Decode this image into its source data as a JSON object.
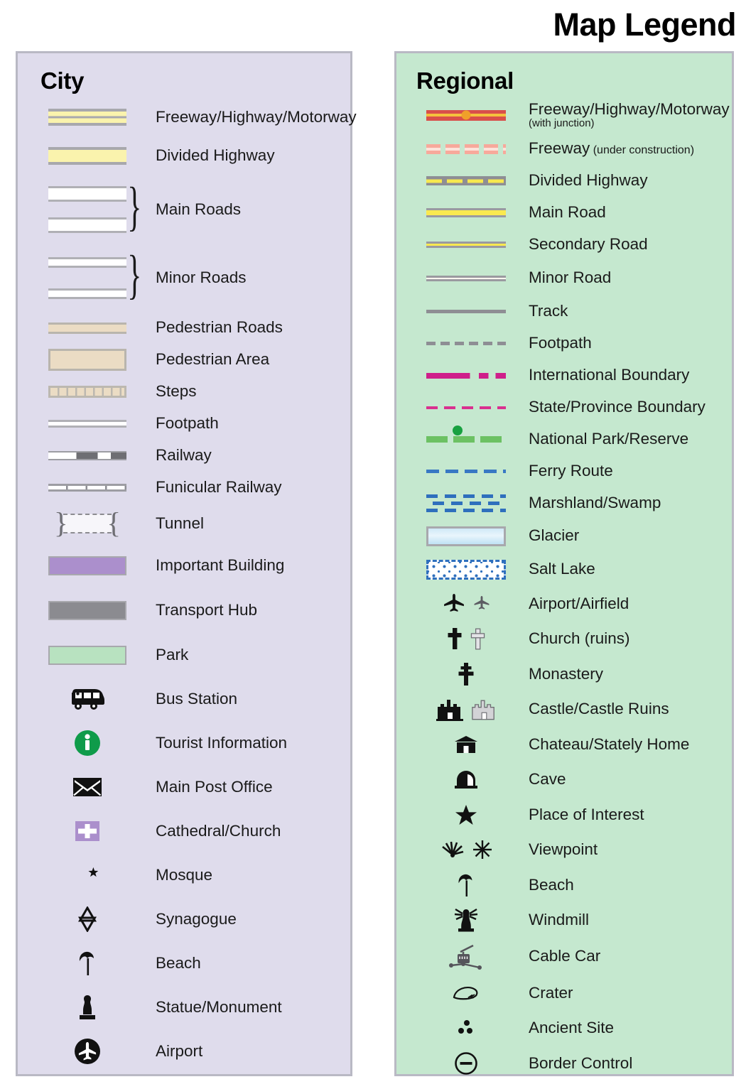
{
  "title": "Map Legend",
  "city": {
    "heading": "City",
    "road_items": [
      {
        "label": "Freeway/Highway/Motorway",
        "symbol": "freeway-bar"
      },
      {
        "label": "Divided Highway",
        "symbol": "divided-highway-bar"
      },
      {
        "label": "Main Roads",
        "symbol": "main-roads-paired-bars"
      },
      {
        "label": "Minor Roads",
        "symbol": "minor-roads-paired-bars"
      },
      {
        "label": "Pedestrian Roads",
        "symbol": "pedestrian-road-bar"
      },
      {
        "label": "Pedestrian Area",
        "symbol": "pedestrian-area-box"
      },
      {
        "label": "Steps",
        "symbol": "steps-bar"
      },
      {
        "label": "Footpath",
        "symbol": "footpath-bar"
      },
      {
        "label": "Railway",
        "symbol": "railway-bar"
      },
      {
        "label": "Funicular Railway",
        "symbol": "funicular-railway-bar"
      },
      {
        "label": "Tunnel",
        "symbol": "tunnel-bracket"
      },
      {
        "label": "Important Building",
        "symbol": "important-building-swatch"
      },
      {
        "label": "Transport Hub",
        "symbol": "transport-hub-swatch"
      },
      {
        "label": "Park",
        "symbol": "park-swatch"
      }
    ],
    "icon_items": [
      {
        "label": "Bus Station",
        "symbol": "bus-icon"
      },
      {
        "label": "Tourist Information",
        "symbol": "tourist-information-icon"
      },
      {
        "label": "Main Post Office",
        "symbol": "envelope-icon"
      },
      {
        "label": "Cathedral/Church",
        "symbol": "cathedral-cross-icon"
      },
      {
        "label": "Mosque",
        "symbol": "mosque-crescent-icon"
      },
      {
        "label": "Synagogue",
        "symbol": "star-of-david-icon"
      },
      {
        "label": "Beach",
        "symbol": "beach-parasol-icon"
      },
      {
        "label": "Statue/Monument",
        "symbol": "statue-icon"
      },
      {
        "label": "Airport",
        "symbol": "airport-circle-icon"
      }
    ]
  },
  "regional": {
    "heading": "Regional",
    "line_items": [
      {
        "label": "Freeway/Highway/Motorway",
        "sublabel": "(with junction)",
        "symbol": "regional-freeway-line"
      },
      {
        "label": "Freeway",
        "inline_sub": " (under construction)",
        "symbol": "freeway-under-construction-line"
      },
      {
        "label": "Divided Highway",
        "symbol": "regional-divided-highway-line"
      },
      {
        "label": "Main Road",
        "symbol": "regional-main-road-line"
      },
      {
        "label": "Secondary Road",
        "symbol": "secondary-road-line"
      },
      {
        "label": "Minor Road",
        "symbol": "regional-minor-road-line"
      },
      {
        "label": "Track",
        "symbol": "track-line"
      },
      {
        "label": "Footpath",
        "symbol": "regional-footpath-line"
      },
      {
        "label": "International Boundary",
        "symbol": "international-boundary-line"
      },
      {
        "label": "State/Province Boundary",
        "symbol": "state-boundary-line"
      },
      {
        "label": "National Park/Reserve",
        "symbol": "national-park-line"
      },
      {
        "label": "Ferry Route",
        "symbol": "ferry-route-line"
      },
      {
        "label": "Marshland/Swamp",
        "symbol": "marshland-pattern"
      },
      {
        "label": "Glacier",
        "symbol": "glacier-swatch"
      },
      {
        "label": "Salt Lake",
        "symbol": "salt-lake-swatch"
      }
    ],
    "icon_items": [
      {
        "label": "Airport/Airfield",
        "symbol": "airplane-pair-icon"
      },
      {
        "label": "Church (ruins)",
        "symbol": "church-cross-pair-icon"
      },
      {
        "label": "Monastery",
        "symbol": "monastery-cross-icon"
      },
      {
        "label": "Castle/Castle Ruins",
        "symbol": "castle-pair-icon"
      },
      {
        "label": "Chateau/Stately Home",
        "symbol": "chateau-icon"
      },
      {
        "label": "Cave",
        "symbol": "cave-icon"
      },
      {
        "label": "Place of Interest",
        "symbol": "star-icon"
      },
      {
        "label": "Viewpoint",
        "symbol": "viewpoint-pair-icon"
      },
      {
        "label": "Beach",
        "symbol": "beach-parasol-icon"
      },
      {
        "label": "Windmill",
        "symbol": "windmill-icon"
      },
      {
        "label": "Cable Car",
        "symbol": "cable-car-icon"
      },
      {
        "label": "Crater",
        "symbol": "crater-icon"
      },
      {
        "label": "Ancient Site",
        "symbol": "ancient-site-icon"
      },
      {
        "label": "Border Control",
        "symbol": "border-control-icon"
      }
    ]
  },
  "colors": {
    "city_panel_bg": "#dfdcec",
    "regional_panel_bg": "#c5e8cf",
    "panel_border": "#b9b9c4",
    "highway_yellow": "#faf3ad",
    "road_yellow": "#fae94f",
    "freeway_red": "#d94f4a",
    "junction_orange": "#f0a02a",
    "pedestrian_tan": "#ebdcc4",
    "important_building_purple": "#ab8fcc",
    "transport_hub_gray": "#8b8b90",
    "park_green": "#b8e2c0",
    "boundary_magenta": "#cf1f8a",
    "park_line_green": "#6cc163",
    "ferry_blue": "#3878c4",
    "tourist_info_green": "#0f9b4a"
  }
}
